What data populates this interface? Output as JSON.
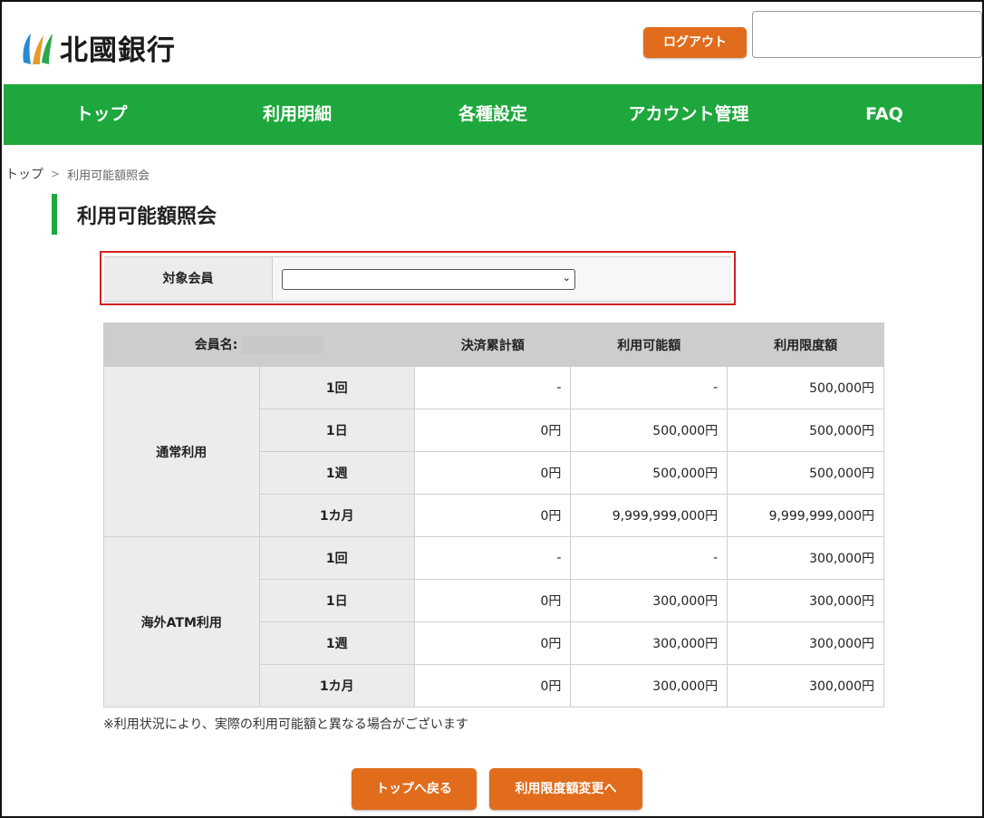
{
  "header": {
    "bank_name": "北國銀行",
    "logout_label": "ログアウト"
  },
  "nav": {
    "items": [
      {
        "label": "トップ"
      },
      {
        "label": "利用明細"
      },
      {
        "label": "各種設定"
      },
      {
        "label": "アカウント管理"
      },
      {
        "label": "FAQ"
      }
    ]
  },
  "breadcrumb": {
    "home": "トップ",
    "current": "利用可能額照会"
  },
  "page": {
    "title": "利用可能額照会"
  },
  "selector": {
    "label": "対象会員",
    "value": ""
  },
  "table": {
    "member_label": "会員名:",
    "columns": [
      "決済累計額",
      "利用可能額",
      "利用限度額"
    ],
    "groups": [
      {
        "name": "通常利用",
        "rows": [
          {
            "period": "1回",
            "values": [
              "-",
              "-",
              "500,000円"
            ]
          },
          {
            "period": "1日",
            "values": [
              "0円",
              "500,000円",
              "500,000円"
            ]
          },
          {
            "period": "1週",
            "values": [
              "0円",
              "500,000円",
              "500,000円"
            ]
          },
          {
            "period": "1カ月",
            "values": [
              "0円",
              "9,999,999,000円",
              "9,999,999,000円"
            ]
          }
        ]
      },
      {
        "name": "海外ATM利用",
        "rows": [
          {
            "period": "1回",
            "values": [
              "-",
              "-",
              "300,000円"
            ]
          },
          {
            "period": "1日",
            "values": [
              "0円",
              "300,000円",
              "300,000円"
            ]
          },
          {
            "period": "1週",
            "values": [
              "0円",
              "300,000円",
              "300,000円"
            ]
          },
          {
            "period": "1カ月",
            "values": [
              "0円",
              "300,000円",
              "300,000円"
            ]
          }
        ]
      }
    ]
  },
  "note": "※利用状況により、実際の利用可能額と異なる場合がございます",
  "buttons": {
    "back_top": "トップへ戻る",
    "change_limit": "利用限度額変更へ"
  },
  "colors": {
    "nav_green": "#1ea73c",
    "button_orange": "#e06c1c",
    "highlight_red": "#d02020"
  }
}
